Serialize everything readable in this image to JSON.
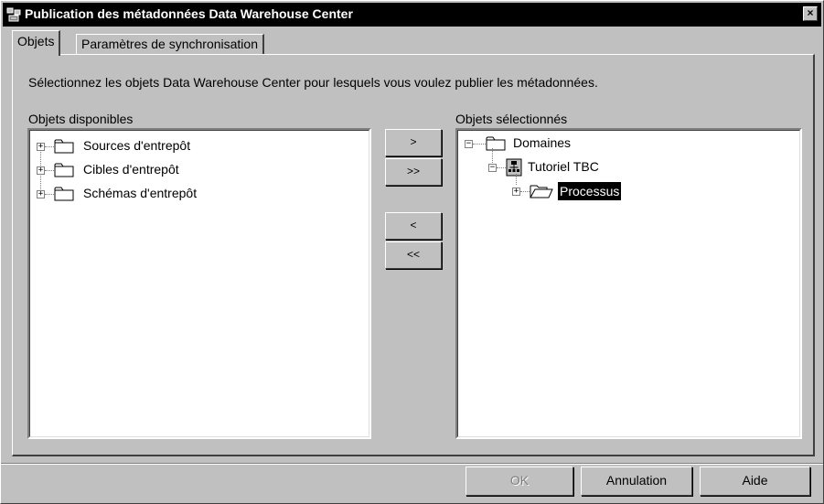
{
  "window": {
    "title": "Publication des métadonnées Data Warehouse Center",
    "close_glyph": "×"
  },
  "tabs": [
    {
      "label": "Objets",
      "active": true
    },
    {
      "label": "Paramètres de synchronisation",
      "active": false
    }
  ],
  "instruction": "Sélectionnez les objets Data Warehouse Center pour lesquels vous voulez publier les métadonnées.",
  "available": {
    "label": "Objets disponibles",
    "items": [
      {
        "label": "Sources d'entrepôt",
        "expander": "+",
        "icon": "folder-icon"
      },
      {
        "label": "Cibles d'entrepôt",
        "expander": "+",
        "icon": "folder-icon"
      },
      {
        "label": "Schémas d'entrepôt",
        "expander": "+",
        "icon": "folder-icon"
      }
    ]
  },
  "selected": {
    "label": "Objets sélectionnés",
    "items": [
      {
        "label": "Domaines",
        "expander": "−",
        "icon": "folder-icon",
        "level": 0
      },
      {
        "label": "Tutoriel TBC",
        "expander": "−",
        "icon": "subject-area-icon",
        "level": 1
      },
      {
        "label": "Processus",
        "expander": "+",
        "icon": "open-folder-icon",
        "level": 2,
        "selected": true
      }
    ]
  },
  "move_buttons": {
    "add": ">",
    "add_all": ">>",
    "remove": "<",
    "remove_all": "<<"
  },
  "footer": {
    "ok": "OK",
    "cancel": "Annulation",
    "help": "Aide"
  },
  "colors": {
    "titlebar": "#000000",
    "dialog_bg": "#c0c0c0",
    "selection": "#000000"
  }
}
